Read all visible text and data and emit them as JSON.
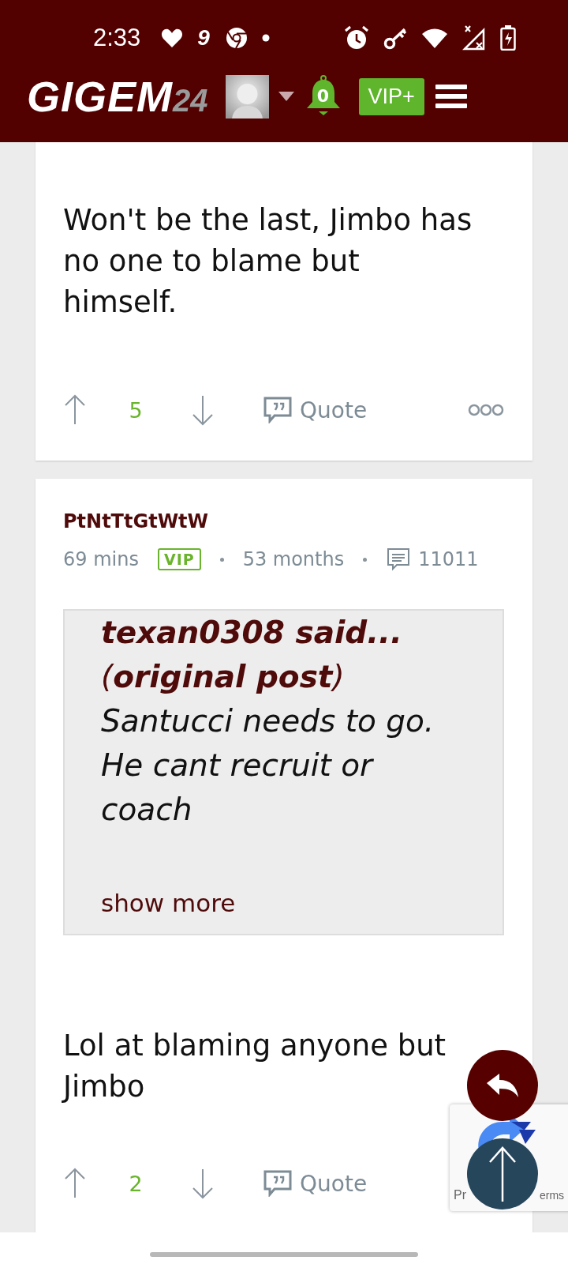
{
  "status_bar": {
    "time": "2:33",
    "app_icon_text": "9"
  },
  "header": {
    "logo_main": "GIGEM",
    "logo_suffix": "24",
    "notifications": "0",
    "vip_button": "VIP+"
  },
  "posts": [
    {
      "body": "Won't be the last, Jimbo has no one to blame but himself.",
      "actions": {
        "score": "5",
        "quote": "Quote",
        "more_menu": true
      }
    },
    {
      "author": "PtNtTtGtWtW",
      "meta": {
        "time": "69 mins",
        "badge": "VIP",
        "tenure": "53 months",
        "post_count": "11011"
      },
      "quote": {
        "attribution": "texan0308 said...",
        "source": "(**original post**)",
        "text": "Santucci needs to go. He cant recruit or coach",
        "more": "show more"
      },
      "body": "Lol at blaming anyone but Jimbo",
      "actions": {
        "score": "2",
        "quote": "Quote"
      }
    }
  ],
  "captcha": {
    "text_left": "Pr",
    "text_right": "erms"
  }
}
